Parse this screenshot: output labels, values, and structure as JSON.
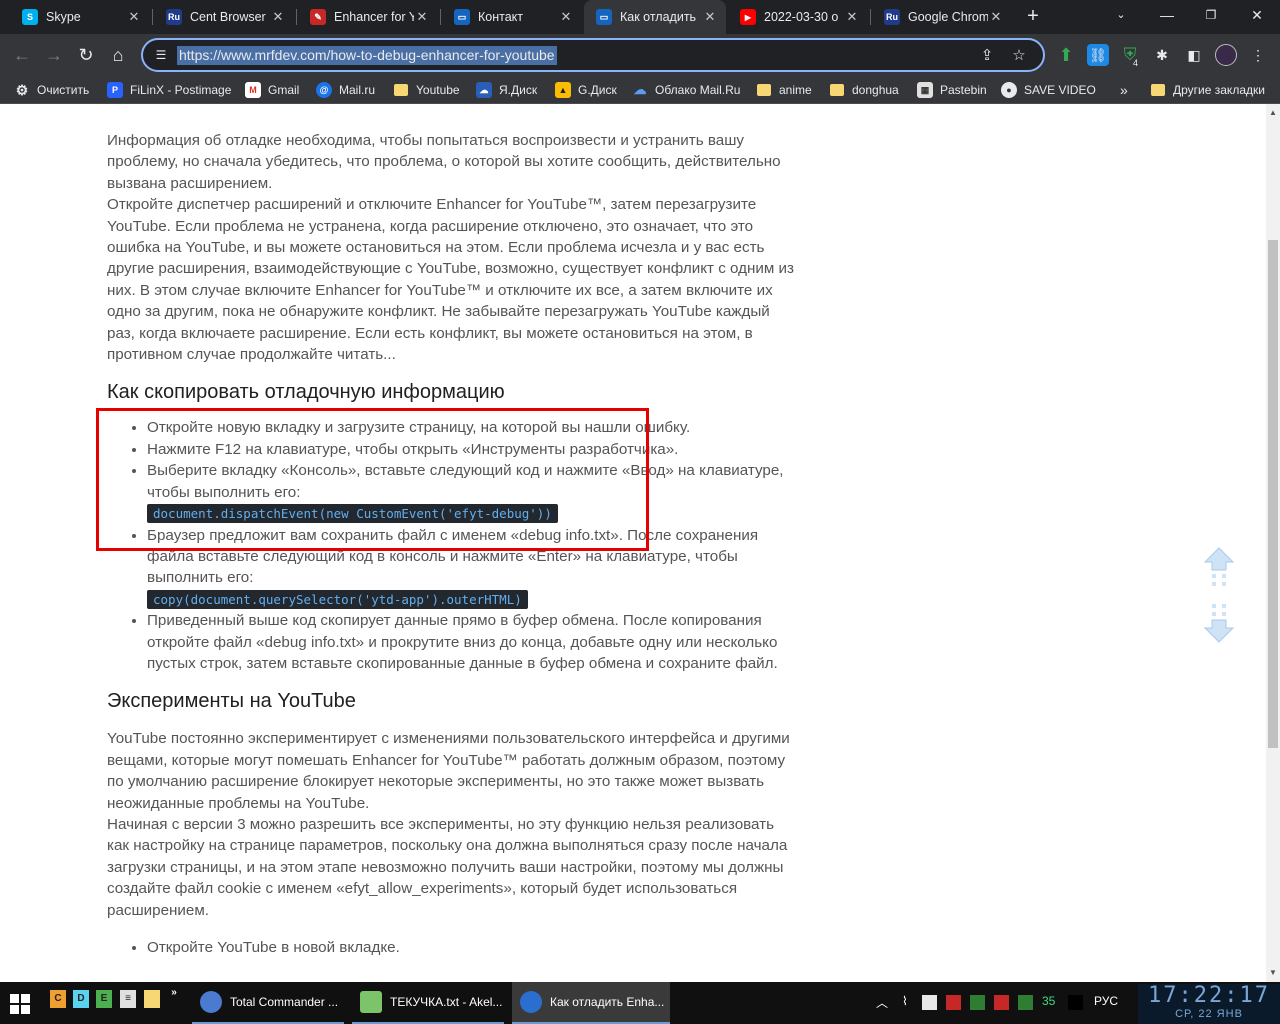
{
  "browser": {
    "tabs": [
      {
        "label": "Skype",
        "icon": "skype-icon",
        "color": "#00aff0",
        "glyph": "S"
      },
      {
        "label": "Cent Browser",
        "icon": "ru-icon",
        "color": "#1f3b8a",
        "glyph": "Ru"
      },
      {
        "label": "Enhancer for Y",
        "icon": "enhancer-icon",
        "color": "#c62828",
        "glyph": "✎"
      },
      {
        "label": "Контакт",
        "icon": "monitor-icon",
        "color": "#1565c0",
        "glyph": "▭"
      },
      {
        "label": "Как отладить",
        "icon": "monitor-icon",
        "color": "#1565c0",
        "glyph": "▭"
      },
      {
        "label": "2022-03-30 o",
        "icon": "youtube-icon",
        "color": "#ff0000",
        "glyph": "▶"
      },
      {
        "label": "Google Chrom",
        "icon": "ru-icon",
        "color": "#1f3b8a",
        "glyph": "Ru"
      }
    ],
    "active_tab": 4,
    "url": "https://www.mrfdev.com/how-to-debug-enhancer-for-youtube",
    "extension_badge": "4"
  },
  "bookmarks": [
    {
      "label": "Очистить",
      "icon": "gear-icon"
    },
    {
      "label": "FiLinX - Postimage",
      "icon": "postimage-icon"
    },
    {
      "label": "Gmail",
      "icon": "gmail-icon"
    },
    {
      "label": "Mail.ru",
      "icon": "at-icon"
    },
    {
      "label": "Youtube",
      "icon": "folder-icon"
    },
    {
      "label": "Я.Диск",
      "icon": "yadisk-icon"
    },
    {
      "label": "G.Диск",
      "icon": "gdrive-icon"
    },
    {
      "label": "Облако Mail.Ru",
      "icon": "cloud-icon"
    },
    {
      "label": "anime",
      "icon": "folder-icon"
    },
    {
      "label": "donghua",
      "icon": "folder-icon"
    },
    {
      "label": "Pastebin",
      "icon": "pastebin-icon"
    },
    {
      "label": "SAVE VIDEO",
      "icon": "globe-icon"
    }
  ],
  "bookmarks_more": "»",
  "bookmarks_other": "Другие закладки",
  "article": {
    "para1": "Информация об отладке необходима, чтобы попытаться воспроизвести и устранить вашу проблему, но сначала убедитесь, что проблема, о которой вы хотите сообщить, действительно вызвана расширением.",
    "para2": "Откройте диспетчер расширений и отключите Enhancer for YouTube™, затем перезагрузите YouTube. Если проблема не устранена, когда расширение отключено, это означает, что это ошибка на YouTube, и вы можете остановиться на этом. Если проблема исчезла и у вас есть другие расширения, взаимодействующие с YouTube, возможно, существует конфликт с одним из них. В этом случае включите Enhancer for YouTube™ и отключите их все, а затем включите их одно за другим, пока не обнаружите конфликт. Не забывайте перезагружать YouTube каждый раз, когда включаете расширение. Если есть конфликт, вы можете остановиться на этом, в противном случае продолжайте читать...",
    "heading1": "Как скопировать отладочную информацию",
    "step1": "Откройте новую вкладку и загрузите страницу, на которой вы нашли ошибку.",
    "step2": "Нажмите F12 на клавиатуре, чтобы открыть «Инструменты разработчика».",
    "step3": "Выберите вкладку «Консоль», вставьте следующий код и нажмите «Ввод» на клавиатуре, чтобы выполнить его:",
    "code1": "document.dispatchEvent(new CustomEvent('efyt-debug'))",
    "step4": "Браузер предложит вам сохранить файл с именем «debug info.txt». После сохранения файла вставьте следующий код в консоль и нажмите «Enter» на клавиатуре, чтобы выполнить его:",
    "code2": "copy(document.querySelector('ytd-app').outerHTML)",
    "step5": "Приведенный выше код скопирует данные прямо в буфер обмена. После копирования откройте файл «debug info.txt» и прокрутите вниз до конца, добавьте одну или несколько пустых строк, затем вставьте скопированные данные в буфер обмена и сохраните файл.",
    "heading2": "Эксперименты на YouTube",
    "para3": "YouTube постоянно экспериментирует с изменениями пользовательского интерфейса и другими вещами, которые могут помешать Enhancer for YouTube™ работать должным образом, поэтому по умолчанию расширение блокирует некоторые эксперименты, но это также может вызвать неожиданные проблемы на YouTube.",
    "para4": "Начиная с версии 3 можно разрешить все эксперименты, но эту функцию нельзя реализовать как настройку на странице параметров, поскольку она должна выполняться сразу после начала загрузки страницы, и на этом этапе невозможно получить ваши настройки, поэтому мы должны создайте файл cookie с именем «efyt_allow_experiments», который будет использоваться расширением.",
    "step6": "Откройте YouTube в новой вкладке."
  },
  "taskbar": {
    "quick_launch": [
      "C",
      "D",
      "E"
    ],
    "tasks": [
      {
        "label": "Total Commander ...",
        "icon": "total-commander-icon"
      },
      {
        "label": "ТЕКУЧКА.txt - Akel...",
        "icon": "akelpad-icon"
      },
      {
        "label": "Как отладить Enha...",
        "icon": "browser-icon"
      }
    ],
    "tray_count": "35",
    "language": "РУС",
    "time": "17:22:17",
    "date": "СР, 22 ЯНВ"
  },
  "colors": {
    "accent": "#8ab4f8",
    "highlight_box": "#e60000",
    "code_bg": "#23272e",
    "code_text": "#61afef"
  }
}
